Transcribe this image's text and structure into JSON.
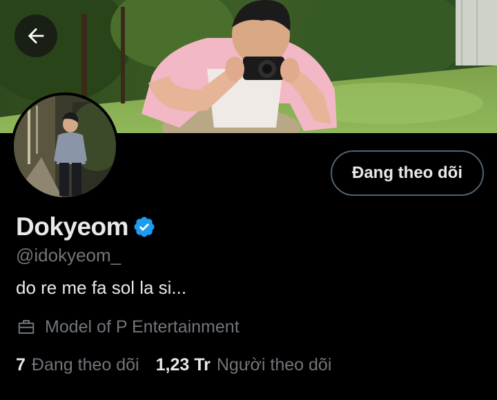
{
  "profile": {
    "display_name": "Dokyeom",
    "handle": "@idokyeom_",
    "bio": "do re me fa sol la si...",
    "work": "Model of P Entertainment",
    "verified": true,
    "accent_color": "#1d9bf0"
  },
  "actions": {
    "follow_label": "Đang theo dõi",
    "back_icon": "arrow-left-icon"
  },
  "stats": {
    "following_count": "7",
    "following_label": "Đang theo dõi",
    "followers_count": "1,23 Tr",
    "followers_label": "Người theo dõi"
  },
  "colors": {
    "background": "#000000",
    "primary_text": "#e7e9ea",
    "secondary_text": "#71767b",
    "button_border": "#536471"
  }
}
